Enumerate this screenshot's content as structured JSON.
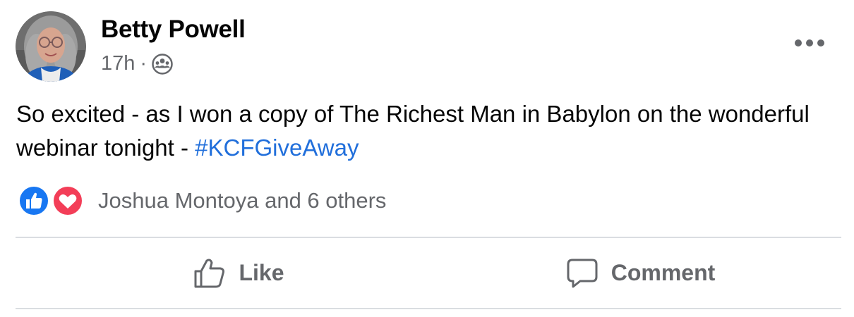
{
  "author": {
    "name": "Betty Powell",
    "timestamp": "17h",
    "separator": "·",
    "audience_icon": "friends-icon"
  },
  "more_icon": "more-horizontal-icon",
  "post": {
    "text": "So excited - as I won a copy of The Richest Man in Babylon on the wonderful webinar tonight - ",
    "hashtag": "#KCFGiveAway"
  },
  "reactions": {
    "types": [
      "like",
      "love"
    ],
    "summary": "Joshua Montoya and 6 others"
  },
  "actions": {
    "like_label": "Like",
    "comment_label": "Comment"
  },
  "colors": {
    "hashtag": "#216fdb",
    "secondary_text": "#65676b",
    "like_blue": "#1877f2",
    "love_red": "#f33e58",
    "divider": "#dadde1"
  }
}
